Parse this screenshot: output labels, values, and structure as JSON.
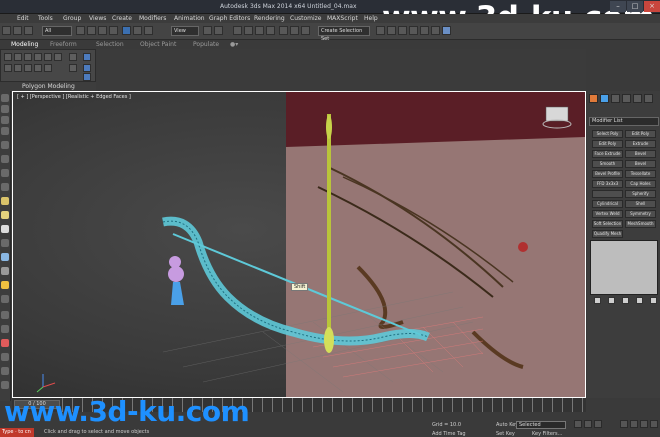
{
  "titlebar": {
    "title": "Autodesk 3ds Max 2014 x64     Untitled_04.max",
    "watermark": "www.3d-ku.com"
  },
  "menu": [
    "Edit",
    "Tools",
    "Group",
    "Views",
    "Create",
    "Modifiers",
    "Animation",
    "Graph Editors",
    "Rendering",
    "Customize",
    "MAXScript",
    "Help"
  ],
  "toolbar": {
    "filter_value": "All",
    "view_value": "View",
    "named_sel": "Create Selection Set"
  },
  "ribbon": {
    "tabs": [
      "Modeling",
      "Freeform",
      "Selection",
      "Object Paint",
      "Populate"
    ],
    "panel_label": "Polygon Modeling"
  },
  "viewport": {
    "label": "[ + ] [Perspective ] [Realistic + Edged Faces ]",
    "tooltip": "Shift"
  },
  "command_panel": {
    "modifier_list": "Modifier List",
    "buttons": [
      "Select Poly",
      "Edit Poly",
      "Edit Poly",
      "Extrude",
      "Face Extrude",
      "Bevel",
      "Smooth",
      "Bevel",
      "Bevel Profile",
      "Tessellate",
      "FFD 3x3x3",
      "Cap Holes",
      "",
      "Spherify",
      "Cylindrical",
      "Shell",
      "Vertex Weld",
      "Symmetry",
      "Soft Selection",
      "MeshSmooth",
      "Quadify Mesh",
      ""
    ]
  },
  "timeline": {
    "slider": "0 / 100"
  },
  "status": {
    "hint": "Click and drag to select and move objects",
    "grid": "Grid = 10.0",
    "add_tag": "Add Time Tag",
    "auto_key": "Auto Key",
    "set_key": "Set Key",
    "selected": "Selected",
    "key_filters": "Key Filters...",
    "bottom_watermark": "www.3d-ku.com",
    "corner_tag": "Type · to cn"
  }
}
